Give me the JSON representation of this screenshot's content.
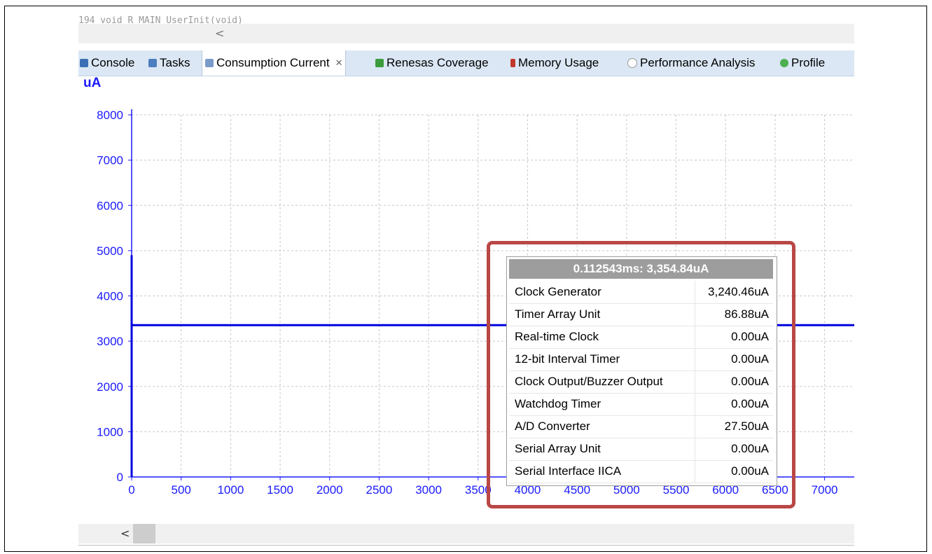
{
  "code_line": {
    "text": "194              void R_MAIN_UserInit(void)"
  },
  "tabs": [
    {
      "label": "Console",
      "icon": "console-icon",
      "color": "#3a6fb5"
    },
    {
      "label": "Tasks",
      "icon": "tasks-icon",
      "color": "#4b7fbf"
    },
    {
      "label": "Consumption Current",
      "icon": "consumption-chart-icon",
      "color": "#7a9bc9",
      "active": true,
      "close": "✕"
    },
    {
      "label": "Renesas Coverage",
      "icon": "coverage-icon",
      "color": "#3c9b3c"
    },
    {
      "label": "Memory Usage",
      "icon": "memory-icon",
      "color": "#c0392b"
    },
    {
      "label": "Performance Analysis",
      "icon": "performance-icon",
      "color": "#9a9a9a"
    },
    {
      "label": "Profile",
      "icon": "profile-icon",
      "color": "#4caf50"
    }
  ],
  "chart_data": {
    "type": "line",
    "ylabel": "uA",
    "xlim": [
      0,
      7300
    ],
    "ylim": [
      0,
      8000
    ],
    "x_ticks": [
      0,
      500,
      1000,
      1500,
      2000,
      2500,
      3000,
      3500,
      4000,
      4500,
      5000,
      5500,
      6000,
      6500,
      7000
    ],
    "y_ticks": [
      0,
      1000,
      2000,
      3000,
      4000,
      5000,
      6000,
      7000,
      8000
    ],
    "grid": true,
    "series": [
      {
        "x": [
          0,
          0,
          0,
          7300
        ],
        "y": [
          0,
          4900,
          3354.84,
          3354.84
        ],
        "color": "#0000dd"
      }
    ]
  },
  "tooltip": {
    "title": "0.112543ms: 3,354.84uA",
    "rows": [
      {
        "name": "Clock Generator",
        "value": "3,240.46uA"
      },
      {
        "name": "Timer Array Unit",
        "value": "86.88uA"
      },
      {
        "name": "Real-time Clock",
        "value": "0.00uA"
      },
      {
        "name": "12-bit Interval Timer",
        "value": "0.00uA"
      },
      {
        "name": "Clock Output/Buzzer Output",
        "value": "0.00uA"
      },
      {
        "name": "Watchdog Timer",
        "value": "0.00uA"
      },
      {
        "name": "A/D Converter",
        "value": "27.50uA"
      },
      {
        "name": "Serial Array Unit",
        "value": "0.00uA"
      },
      {
        "name": "Serial Interface IICA",
        "value": "0.00uA"
      }
    ]
  },
  "colors": {
    "accent": "#1a1aff",
    "highlight": "#b94745",
    "tab_bar": "#dbe7f4"
  },
  "scroll": {
    "left_arrow": "<"
  }
}
